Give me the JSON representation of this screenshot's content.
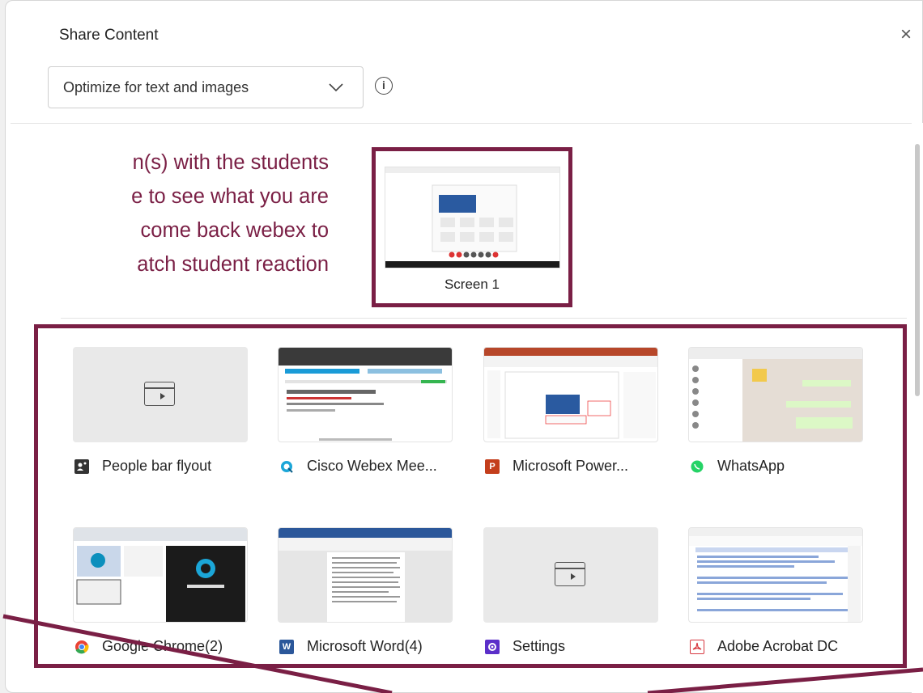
{
  "dialog": {
    "title": "Share Content",
    "close_symbol": "×",
    "optimize_select": {
      "value": "Optimize for text and images"
    },
    "info_symbol": "i"
  },
  "annotation": {
    "lines": [
      "n(s) with the students",
      "e to see what you are",
      "come back webex to",
      "atch student reaction"
    ],
    "color": "#7a1f45"
  },
  "screens": [
    {
      "label": "Screen 1"
    }
  ],
  "apps": [
    {
      "label": "People bar flyout",
      "icon": "people-bar-icon"
    },
    {
      "label": "Cisco Webex Mee...",
      "icon": "webex-icon"
    },
    {
      "label": "Microsoft Power...",
      "icon": "powerpoint-icon"
    },
    {
      "label": "WhatsApp",
      "icon": "whatsapp-icon"
    },
    {
      "label": "Google Chrome(2)",
      "icon": "chrome-icon"
    },
    {
      "label": "Microsoft Word(4)",
      "icon": "word-icon"
    },
    {
      "label": "Settings",
      "icon": "settings-icon"
    },
    {
      "label": "Adobe Acrobat DC",
      "icon": "acrobat-icon"
    }
  ]
}
